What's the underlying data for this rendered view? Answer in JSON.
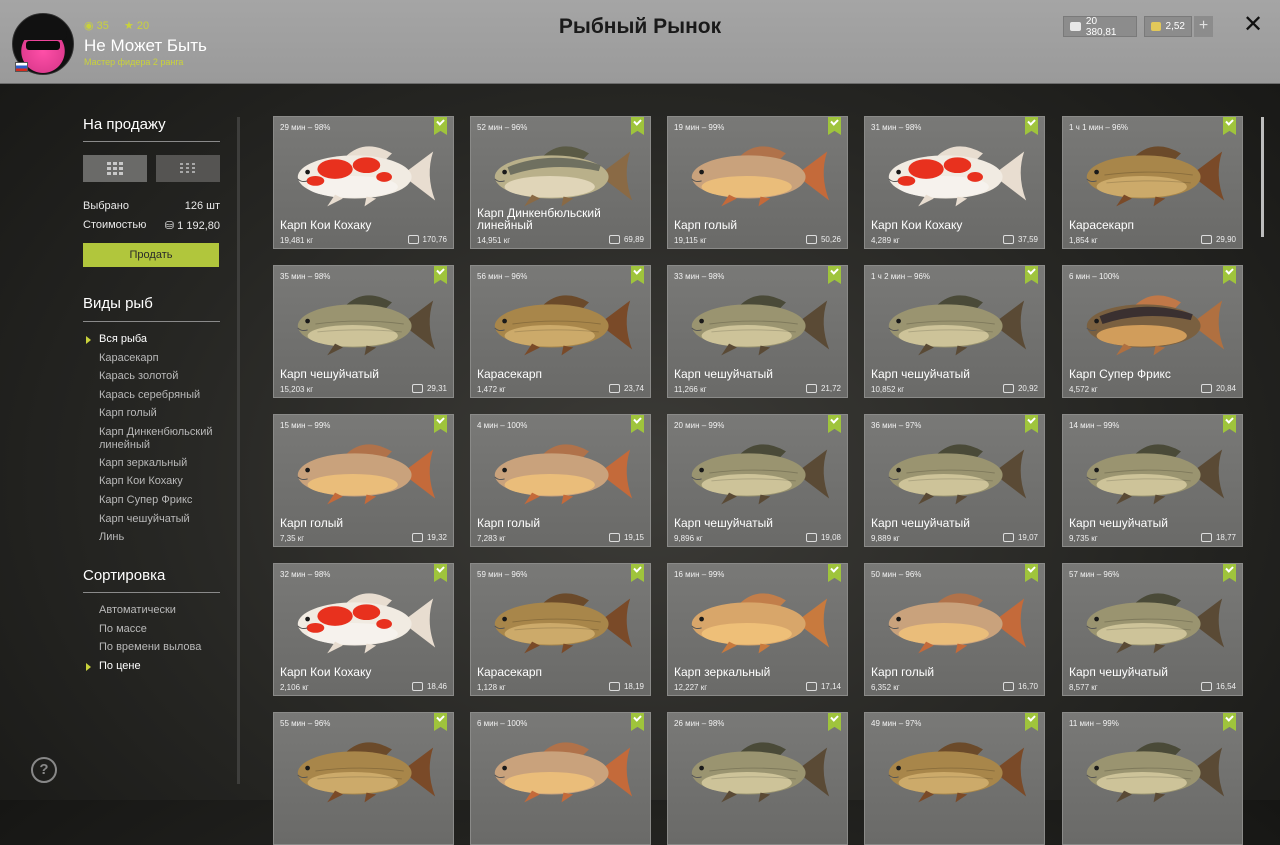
{
  "header": {
    "stats": {
      "coins": "35",
      "stars": "20"
    },
    "player_name": "Не Может Быть",
    "player_rank": "Мастер фидера 2 ранга",
    "title": "Рыбный Рынок",
    "silver": "20 380,81",
    "gold": "2,52",
    "plus_label": "+",
    "close_label": "✕"
  },
  "sidebar": {
    "sale_heading": "На продажу",
    "selected_label": "Выбрано",
    "selected_value": "126 шт",
    "cost_label": "Стоимостью",
    "cost_value": "1 192,80",
    "sell_button": "Продать",
    "species_heading": "Виды рыб",
    "species": [
      "Вся рыба",
      "Карасекарп",
      "Карась золотой",
      "Карась серебряный",
      "Карп голый",
      "Карп Динкенбюльский линейный",
      "Карп зеркальный",
      "Карп Кои Кохаку",
      "Карп Супер Фрикс",
      "Карп чешуйчатый",
      "Линь"
    ],
    "species_selected": 0,
    "sort_heading": "Сортировка",
    "sort_options": [
      "Автоматически",
      "По массе",
      "По времени вылова",
      "По цене"
    ],
    "sort_selected": 3,
    "help_label": "?"
  },
  "colors": {
    "accent": "#b1c63c",
    "check": "#9fc43c",
    "header_bg": "#a0a0a0"
  },
  "fish_cards": [
    {
      "time": "29 мин – 98%",
      "name": "Карп Кои Кохаку",
      "weight": "19,481 кг",
      "price": "170,76",
      "kind": "koi"
    },
    {
      "time": "52 мин – 96%",
      "name": "Карп Динкенбюльский линейный",
      "weight": "14,951 кг",
      "price": "69,89",
      "kind": "linear"
    },
    {
      "time": "19 мин – 99%",
      "name": "Карп голый",
      "weight": "19,115 кг",
      "price": "50,26",
      "kind": "leather"
    },
    {
      "time": "31 мин – 98%",
      "name": "Карп Кои Кохаку",
      "weight": "4,289 кг",
      "price": "37,59",
      "kind": "koi"
    },
    {
      "time": "1 ч 1 мин – 96%",
      "name": "Карасекарп",
      "weight": "1,854 кг",
      "price": "29,90",
      "kind": "goldcarp"
    },
    {
      "time": "35 мин – 98%",
      "name": "Карп чешуйчатый",
      "weight": "15,203 кг",
      "price": "29,31",
      "kind": "common"
    },
    {
      "time": "56 мин – 96%",
      "name": "Карасекарп",
      "weight": "1,472 кг",
      "price": "23,74",
      "kind": "goldcarp"
    },
    {
      "time": "33 мин – 98%",
      "name": "Карп чешуйчатый",
      "weight": "11,266 кг",
      "price": "21,72",
      "kind": "common"
    },
    {
      "time": "1 ч 2 мин – 96%",
      "name": "Карп чешуйчатый",
      "weight": "10,852 кг",
      "price": "20,92",
      "kind": "common"
    },
    {
      "time": "6 мин – 100%",
      "name": "Карп Супер Фрикс",
      "weight": "4,572 кг",
      "price": "20,84",
      "kind": "superfrix"
    },
    {
      "time": "15 мин – 99%",
      "name": "Карп голый",
      "weight": "7,35 кг",
      "price": "19,32",
      "kind": "leather"
    },
    {
      "time": "4 мин – 100%",
      "name": "Карп голый",
      "weight": "7,283 кг",
      "price": "19,15",
      "kind": "leather"
    },
    {
      "time": "20 мин – 99%",
      "name": "Карп чешуйчатый",
      "weight": "9,896 кг",
      "price": "19,08",
      "kind": "common"
    },
    {
      "time": "36 мин – 97%",
      "name": "Карп чешуйчатый",
      "weight": "9,889 кг",
      "price": "19,07",
      "kind": "common"
    },
    {
      "time": "14 мин – 99%",
      "name": "Карп чешуйчатый",
      "weight": "9,735 кг",
      "price": "18,77",
      "kind": "common"
    },
    {
      "time": "32 мин – 98%",
      "name": "Карп Кои Кохаку",
      "weight": "2,106 кг",
      "price": "18,46",
      "kind": "koi"
    },
    {
      "time": "59 мин – 96%",
      "name": "Карасекарп",
      "weight": "1,128 кг",
      "price": "18,19",
      "kind": "goldcarp"
    },
    {
      "time": "16 мин – 99%",
      "name": "Карп зеркальный",
      "weight": "12,227 кг",
      "price": "17,14",
      "kind": "mirror"
    },
    {
      "time": "50 мин – 96%",
      "name": "Карп голый",
      "weight": "6,352 кг",
      "price": "16,70",
      "kind": "leather"
    },
    {
      "time": "57 мин – 96%",
      "name": "Карп чешуйчатый",
      "weight": "8,577 кг",
      "price": "16,54",
      "kind": "common"
    },
    {
      "time": "55 мин – 96%",
      "name": "",
      "weight": "",
      "price": "",
      "kind": "goldcarp"
    },
    {
      "time": "6 мин – 100%",
      "name": "",
      "weight": "",
      "price": "",
      "kind": "leather"
    },
    {
      "time": "26 мин – 98%",
      "name": "",
      "weight": "",
      "price": "",
      "kind": "common"
    },
    {
      "time": "49 мин – 97%",
      "name": "",
      "weight": "",
      "price": "",
      "kind": "goldcarp"
    },
    {
      "time": "11 мин – 99%",
      "name": "",
      "weight": "",
      "price": "",
      "kind": "common"
    }
  ]
}
